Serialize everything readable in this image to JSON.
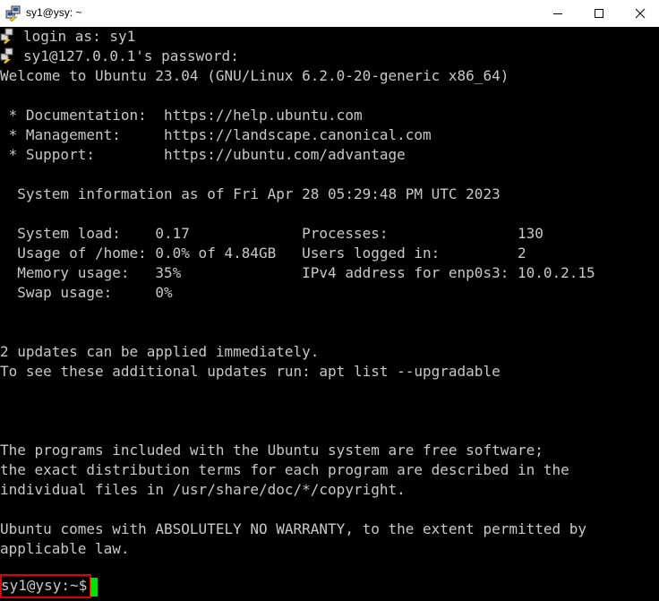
{
  "window": {
    "title": "sy1@ysy: ~",
    "icon": "putty-icon",
    "controls": {
      "minimize": "minimize-icon",
      "maximize": "maximize-icon",
      "close": "close-icon"
    }
  },
  "terminal": {
    "lines": [
      "login as: sy1",
      "sy1@127.0.0.1's password:",
      "Welcome to Ubuntu 23.04 (GNU/Linux 6.2.0-20-generic x86_64)",
      "",
      " * Documentation:  https://help.ubuntu.com",
      " * Management:     https://landscape.canonical.com",
      " * Support:        https://ubuntu.com/advantage",
      "",
      "  System information as of Fri Apr 28 05:29:48 PM UTC 2023",
      "",
      "  System load:    0.17             Processes:               130",
      "  Usage of /home: 0.0% of 4.84GB   Users logged in:         2",
      "  Memory usage:   35%              IPv4 address for enp0s3: 10.0.2.15",
      "  Swap usage:     0%",
      "",
      "",
      "2 updates can be applied immediately.",
      "To see these additional updates run: apt list --upgradable",
      "",
      "",
      "",
      "The programs included with the Ubuntu system are free software;",
      "the exact distribution terms for each program are described in the",
      "individual files in /usr/share/doc/*/copyright.",
      "",
      "Ubuntu comes with ABSOLUTELY NO WARRANTY, to the extent permitted by",
      "applicable law.",
      ""
    ],
    "prompt": "sy1@ysy:~$ ",
    "colors": {
      "background": "#000000",
      "text": "#c8c8c8",
      "cursor": "#00e000",
      "highlight": "#e00000"
    }
  }
}
